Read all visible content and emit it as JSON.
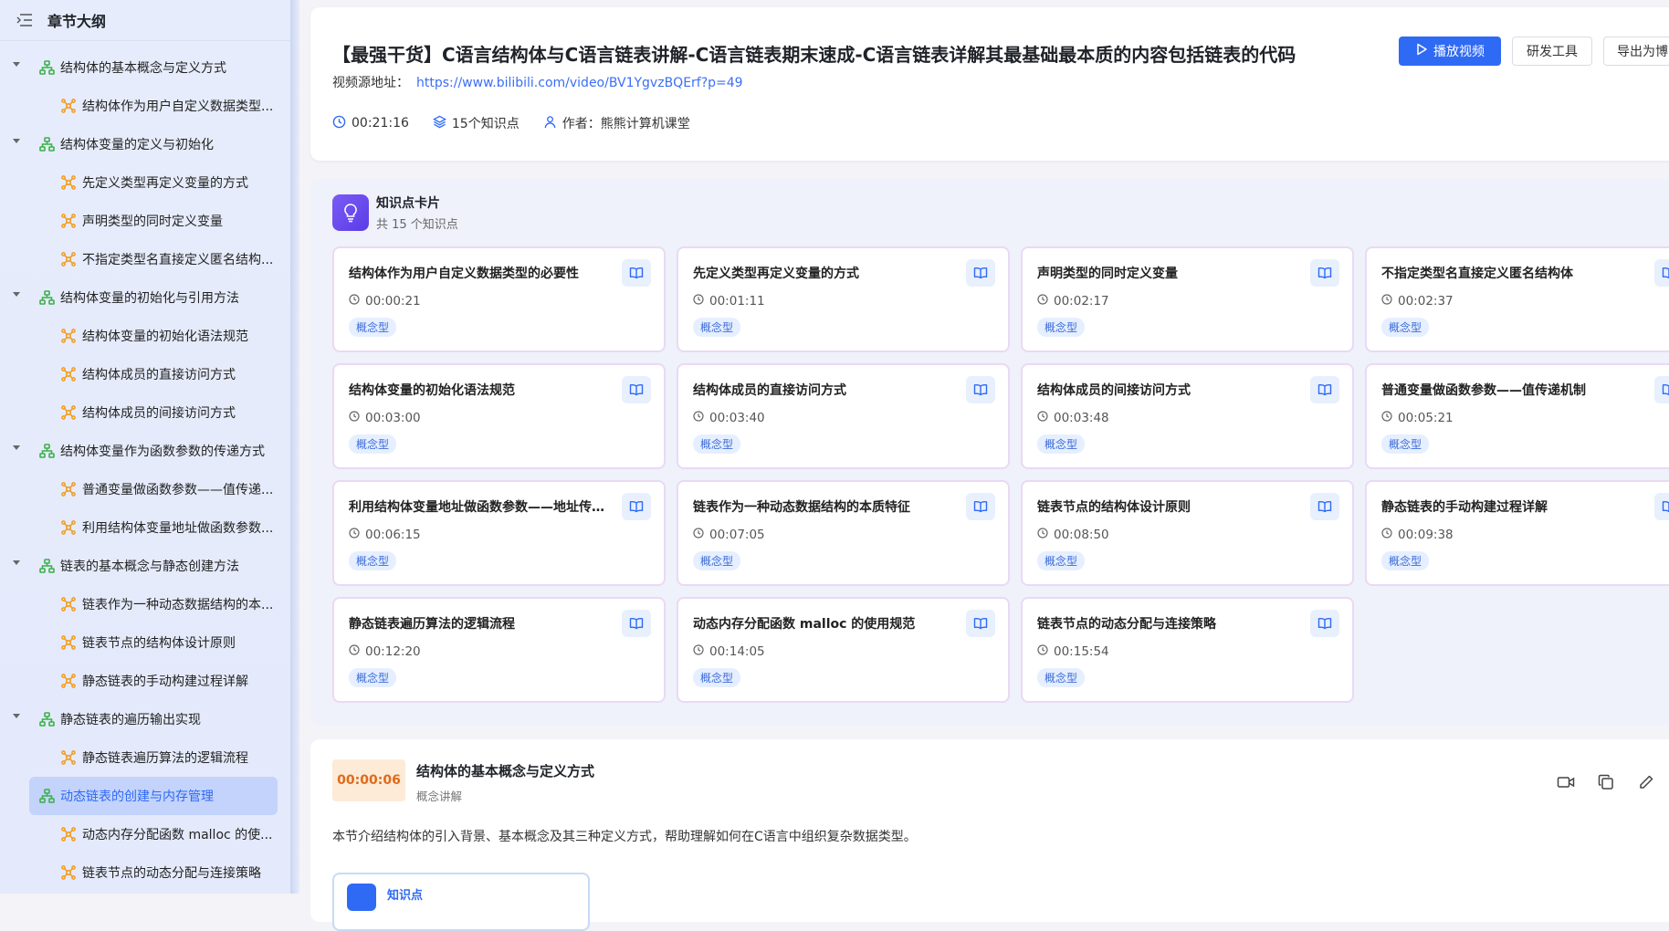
{
  "sidebar": {
    "title": "章节大纲",
    "nodes": [
      {
        "level": 1,
        "label": "结构体的基本概念与定义方式"
      },
      {
        "level": 2,
        "label": "结构体作为用户自定义数据类型..."
      },
      {
        "level": 1,
        "label": "结构体变量的定义与初始化"
      },
      {
        "level": 2,
        "label": "先定义类型再定义变量的方式"
      },
      {
        "level": 2,
        "label": "声明类型的同时定义变量"
      },
      {
        "level": 2,
        "label": "不指定类型名直接定义匿名结构..."
      },
      {
        "level": 1,
        "label": "结构体变量的初始化与引用方法"
      },
      {
        "level": 2,
        "label": "结构体变量的初始化语法规范"
      },
      {
        "level": 2,
        "label": "结构体成员的直接访问方式"
      },
      {
        "level": 2,
        "label": "结构体成员的间接访问方式"
      },
      {
        "level": 1,
        "label": "结构体变量作为函数参数的传递方式"
      },
      {
        "level": 2,
        "label": "普通变量做函数参数——值传递..."
      },
      {
        "level": 2,
        "label": "利用结构体变量地址做函数参数..."
      },
      {
        "level": 1,
        "label": "链表的基本概念与静态创建方法"
      },
      {
        "level": 2,
        "label": "链表作为一种动态数据结构的本..."
      },
      {
        "level": 2,
        "label": "链表节点的结构体设计原则"
      },
      {
        "level": 2,
        "label": "静态链表的手动构建过程详解"
      },
      {
        "level": 1,
        "label": "静态链表的遍历输出实现"
      },
      {
        "level": 2,
        "label": "静态链表遍历算法的逻辑流程"
      },
      {
        "level": 1,
        "label": "动态链表的创建与内存管理",
        "active": true
      },
      {
        "level": 2,
        "label": "动态内存分配函数 malloc 的使..."
      },
      {
        "level": 2,
        "label": "链表节点的动态分配与连接策略"
      }
    ]
  },
  "header": {
    "title": "【最强干货】C语言结构体与C语言链表讲解-C语言链表期末速成-C语言链表详解其最基础最本质的内容包括链表的代码",
    "source_label": "视频源地址：",
    "source_url": "https://www.bilibili.com/video/BV1YgvzBQErf?p=49",
    "duration": "00:21:16",
    "knowledge_count": "15个知识点",
    "author": "作者：熊熊计算机课堂",
    "play_button": "播放视频",
    "dev_tools_button": "研发工具",
    "export_button": "导出为博"
  },
  "knowledge_panel": {
    "title": "知识点卡片",
    "count": "共 15 个知识点",
    "cards": [
      {
        "title": "结构体作为用户自定义数据类型的必要性",
        "time": "00:00:21",
        "tag": "概念型"
      },
      {
        "title": "先定义类型再定义变量的方式",
        "time": "00:01:11",
        "tag": "概念型"
      },
      {
        "title": "声明类型的同时定义变量",
        "time": "00:02:17",
        "tag": "概念型"
      },
      {
        "title": "不指定类型名直接定义匿名结构体",
        "time": "00:02:37",
        "tag": "概念型"
      },
      {
        "title": "结构体变量的初始化语法规范",
        "time": "00:03:00",
        "tag": "概念型"
      },
      {
        "title": "结构体成员的直接访问方式",
        "time": "00:03:40",
        "tag": "概念型"
      },
      {
        "title": "结构体成员的间接访问方式",
        "time": "00:03:48",
        "tag": "概念型"
      },
      {
        "title": "普通变量做函数参数——值传递机制",
        "time": "00:05:21",
        "tag": "概念型"
      },
      {
        "title": "利用结构体变量地址做函数参数——地址传...",
        "time": "00:06:15",
        "tag": "概念型"
      },
      {
        "title": "链表作为一种动态数据结构的本质特征",
        "time": "00:07:05",
        "tag": "概念型"
      },
      {
        "title": "链表节点的结构体设计原则",
        "time": "00:08:50",
        "tag": "概念型"
      },
      {
        "title": "静态链表的手动构建过程详解",
        "time": "00:09:38",
        "tag": "概念型"
      },
      {
        "title": "静态链表遍历算法的逻辑流程",
        "time": "00:12:20",
        "tag": "概念型"
      },
      {
        "title": "动态内存分配函数 malloc 的使用规范",
        "time": "00:14:05",
        "tag": "概念型"
      },
      {
        "title": "链表节点的动态分配与连接策略",
        "time": "00:15:54",
        "tag": "概念型"
      }
    ]
  },
  "section": {
    "time": "00:00:06",
    "title": "结构体的基本概念与定义方式",
    "subtitle": "概念讲解",
    "description": "本节介绍结构体的引入背景、基本概念及其三种定义方式，帮助理解如何在C语言中组织复杂数据类型。",
    "knowledge_label": "知识点"
  },
  "colors": {
    "accent": "#2f6af5",
    "card_border": "#ead9f4",
    "tag_bg": "#e6efff",
    "time_badge_bg": "#fdebd7",
    "time_badge_text": "#e06a1b",
    "tree_icon_l1": "#3bb04a",
    "tree_icon_l2": "#f39a1b"
  },
  "icons": {
    "collapse": "menu-fold-icon",
    "tree_l1": "org-chart-icon",
    "tree_l2": "hub-icon",
    "clock": "clock-icon",
    "layers": "layers-icon",
    "user": "user-icon",
    "play": "play-icon",
    "bulb": "lightbulb-icon",
    "book": "book-icon",
    "video": "video-camera-icon",
    "copy": "copy-icon",
    "edit": "pencil-icon"
  }
}
